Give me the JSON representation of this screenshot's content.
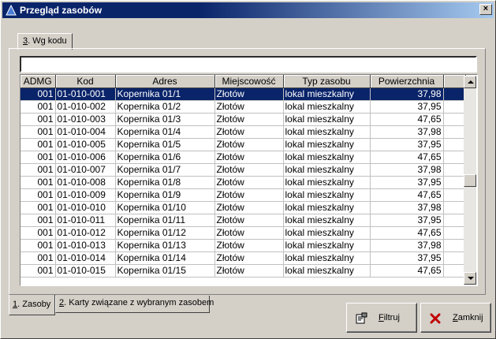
{
  "window": {
    "title": "Przegląd zasobów",
    "close_glyph": "×"
  },
  "top_tab": {
    "key": "3",
    "label": ". Wg kodu"
  },
  "filter": {
    "value": "",
    "placeholder": ""
  },
  "table": {
    "columns": [
      "ADMG",
      "Kod",
      "Adres",
      "Miejscowość",
      "Typ zasobu",
      "Powierzchnia"
    ],
    "rows": [
      {
        "admg": "001",
        "kod": "01-010-001",
        "adres": "Kopernika 01/1",
        "miejscowosc": "Złotów",
        "typ": "lokal mieszkalny",
        "pow": "37,98"
      },
      {
        "admg": "001",
        "kod": "01-010-002",
        "adres": "Kopernika 01/2",
        "miejscowosc": "Złotów",
        "typ": "lokal mieszkalny",
        "pow": "37,95"
      },
      {
        "admg": "001",
        "kod": "01-010-003",
        "adres": "Kopernika 01/3",
        "miejscowosc": "Złotów",
        "typ": "lokal mieszkalny",
        "pow": "47,65"
      },
      {
        "admg": "001",
        "kod": "01-010-004",
        "adres": "Kopernika 01/4",
        "miejscowosc": "Złotów",
        "typ": "lokal mieszkalny",
        "pow": "37,98"
      },
      {
        "admg": "001",
        "kod": "01-010-005",
        "adres": "Kopernika 01/5",
        "miejscowosc": "Złotów",
        "typ": "lokal mieszkalny",
        "pow": "37,95"
      },
      {
        "admg": "001",
        "kod": "01-010-006",
        "adres": "Kopernika 01/6",
        "miejscowosc": "Złotów",
        "typ": "lokal mieszkalny",
        "pow": "47,65"
      },
      {
        "admg": "001",
        "kod": "01-010-007",
        "adres": "Kopernika 01/7",
        "miejscowosc": "Złotów",
        "typ": "lokal mieszkalny",
        "pow": "37,98"
      },
      {
        "admg": "001",
        "kod": "01-010-008",
        "adres": "Kopernika 01/8",
        "miejscowosc": "Złotów",
        "typ": "lokal mieszkalny",
        "pow": "37,95"
      },
      {
        "admg": "001",
        "kod": "01-010-009",
        "adres": "Kopernika 01/9",
        "miejscowosc": "Złotów",
        "typ": "lokal mieszkalny",
        "pow": "47,65"
      },
      {
        "admg": "001",
        "kod": "01-010-010",
        "adres": "Kopernika 01/10",
        "miejscowosc": "Złotów",
        "typ": "lokal mieszkalny",
        "pow": "37,98"
      },
      {
        "admg": "001",
        "kod": "01-010-011",
        "adres": "Kopernika 01/11",
        "miejscowosc": "Złotów",
        "typ": "lokal mieszkalny",
        "pow": "37,95"
      },
      {
        "admg": "001",
        "kod": "01-010-012",
        "adres": "Kopernika 01/12",
        "miejscowosc": "Złotów",
        "typ": "lokal mieszkalny",
        "pow": "47,65"
      },
      {
        "admg": "001",
        "kod": "01-010-013",
        "adres": "Kopernika 01/13",
        "miejscowosc": "Złotów",
        "typ": "lokal mieszkalny",
        "pow": "37,98"
      },
      {
        "admg": "001",
        "kod": "01-010-014",
        "adres": "Kopernika 01/14",
        "miejscowosc": "Złotów",
        "typ": "lokal mieszkalny",
        "pow": "37,95"
      },
      {
        "admg": "001",
        "kod": "01-010-015",
        "adres": "Kopernika 01/15",
        "miejscowosc": "Złotów",
        "typ": "lokal mieszkalny",
        "pow": "47,65"
      }
    ],
    "selected_row": 0
  },
  "bottom_tabs": [
    {
      "key": "1",
      "label": ". Zasoby"
    },
    {
      "key": "2",
      "label": ". Karty związane z wybranym zasobem"
    }
  ],
  "buttons": {
    "filter": {
      "key": "F",
      "label": "iltruj",
      "icon": "filter-icon"
    },
    "close": {
      "key": "Z",
      "label": "amknij",
      "icon": "close-x-icon"
    }
  },
  "colors": {
    "titlebar": "#0a246a",
    "selection": "#0a246a",
    "close_icon": "#c00000"
  }
}
